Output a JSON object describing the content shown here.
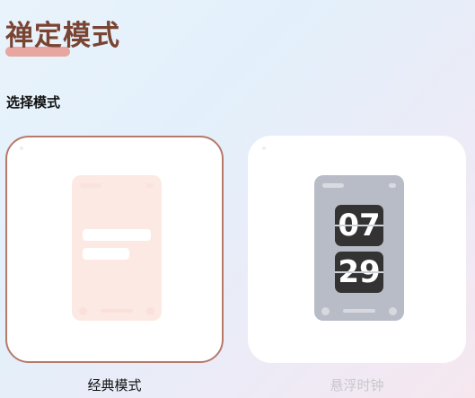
{
  "header": {
    "title": "禅定模式"
  },
  "section": {
    "label": "选择模式"
  },
  "modes": [
    {
      "id": "classic",
      "label": "经典模式",
      "selected": true
    },
    {
      "id": "floating_clock",
      "label": "悬浮时钟",
      "selected": false,
      "clock": {
        "hours": "07",
        "minutes": "29"
      }
    }
  ],
  "colors": {
    "accent": "#b7796a",
    "title": "#7a4433",
    "title_highlight": "#e7a6a0",
    "unselected_label": "#c7c7cd"
  }
}
